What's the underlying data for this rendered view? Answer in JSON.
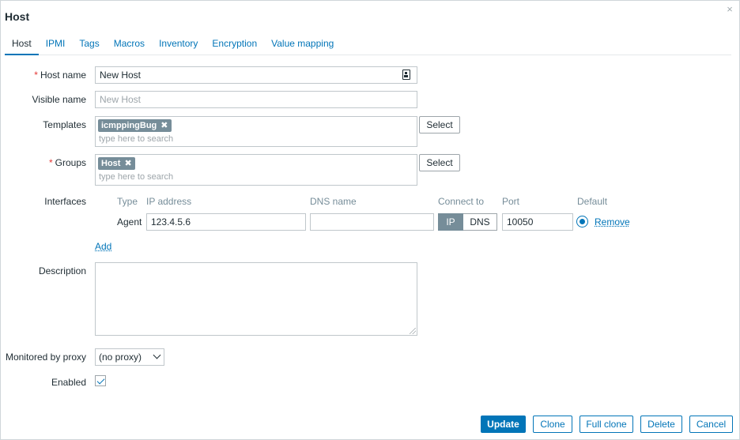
{
  "dialog": {
    "title": "Host",
    "close_icon": "close-icon"
  },
  "tabs": [
    {
      "label": "Host",
      "active": true
    },
    {
      "label": "IPMI"
    },
    {
      "label": "Tags"
    },
    {
      "label": "Macros"
    },
    {
      "label": "Inventory"
    },
    {
      "label": "Encryption"
    },
    {
      "label": "Value mapping"
    }
  ],
  "form": {
    "host_name": {
      "label": "Host name",
      "value": "New Host",
      "required_mark": "*",
      "icon": "id-card-icon"
    },
    "visible_name": {
      "label": "Visible name",
      "placeholder": "New Host"
    },
    "templates": {
      "label": "Templates",
      "tags": [
        "icmppingBug"
      ],
      "placeholder": "type here to search",
      "select_label": "Select"
    },
    "groups": {
      "label": "Groups",
      "required_mark": "*",
      "tags": [
        "Host"
      ],
      "placeholder": "type here to search",
      "select_label": "Select"
    },
    "interfaces": {
      "label": "Interfaces",
      "columns": {
        "type": "Type",
        "ip": "IP address",
        "dns": "DNS name",
        "connect": "Connect to",
        "port": "Port",
        "default": "Default"
      },
      "rows": [
        {
          "type": "Agent",
          "ip": "123.4.5.6",
          "dns": "",
          "connect_ip": "IP",
          "connect_dns": "DNS",
          "connect_selected": "IP",
          "port": "10050",
          "remove": "Remove"
        }
      ],
      "add_label": "Add"
    },
    "description": {
      "label": "Description",
      "value": ""
    },
    "proxy": {
      "label": "Monitored by proxy",
      "value": "(no proxy)"
    },
    "enabled": {
      "label": "Enabled",
      "checked": true
    }
  },
  "footer": {
    "update": "Update",
    "clone": "Clone",
    "full_clone": "Full clone",
    "delete": "Delete",
    "cancel": "Cancel"
  },
  "colors": {
    "accent": "#0275b8",
    "tag_bg": "#768d99",
    "required": "#e33734"
  }
}
